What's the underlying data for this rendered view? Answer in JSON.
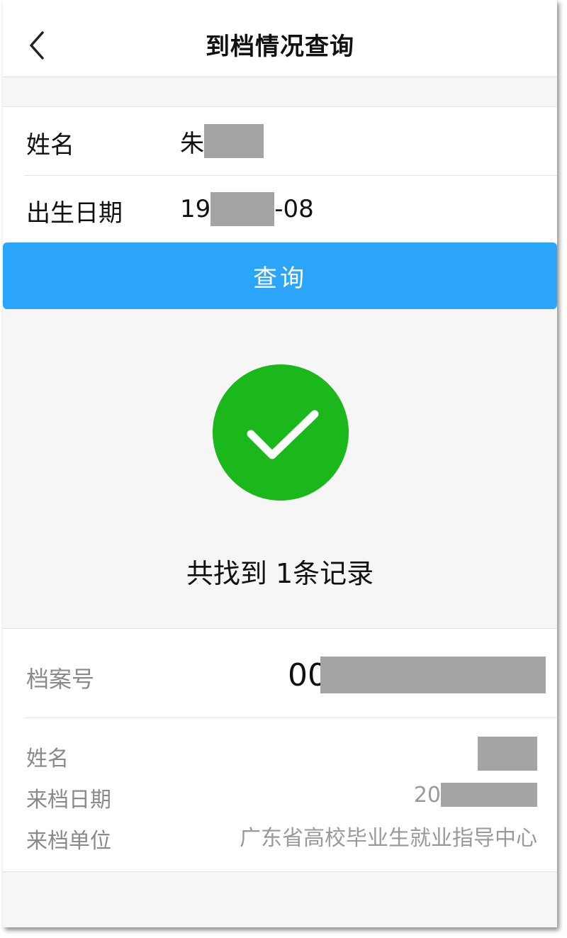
{
  "navbar": {
    "title": "到档情况查询",
    "back_icon": "chevron-left-icon"
  },
  "form": {
    "name_label": "姓名",
    "name_value_visible": "朱",
    "birth_label": "出生日期",
    "birth_prefix": "19",
    "birth_suffix": "-08"
  },
  "query_button": {
    "label": "查询",
    "color": "#2aa5f9"
  },
  "result": {
    "icon": "checkmark-circle-icon",
    "icon_color": "#1bb81b",
    "message": "共找到 1条记录"
  },
  "record": {
    "archive_label": "档案号",
    "archive_value_visible": "00",
    "name_label": "姓名",
    "arrival_date_label": "来档日期",
    "arrival_date_prefix": "20",
    "source_unit_label": "来档单位",
    "source_unit_value": "广东省高校毕业生就业指导中心"
  }
}
